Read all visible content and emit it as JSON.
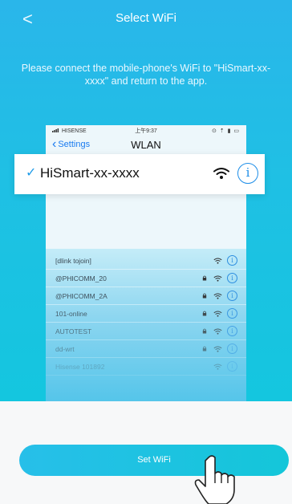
{
  "header": {
    "back_icon": "chevron-left-icon",
    "back_glyph": "<",
    "title": "Select WiFi"
  },
  "instruction": "Please connect the mobile-phone's WiFi to \"HiSmart-xx-xxxx\" and return to the app.",
  "phone": {
    "status": {
      "carrier": "HISENSE",
      "time": "上午9:37",
      "icons": "⊙ ⇡ ▮ ▭"
    },
    "nav": {
      "back_label": "Settings",
      "title": "WLAN"
    },
    "selected_network": {
      "check": "✓",
      "name": "HiSmart-xx-xxxx",
      "info": "i"
    },
    "networks": [
      {
        "name": "[dlink tojoin]",
        "locked": false
      },
      {
        "name": "@PHICOMM_20",
        "locked": true
      },
      {
        "name": "@PHICOMM_2A",
        "locked": true
      },
      {
        "name": "101-online",
        "locked": true
      },
      {
        "name": "AUTOTEST",
        "locked": true
      },
      {
        "name": "dd-wrt",
        "locked": true
      },
      {
        "name": "Hisense 101892",
        "locked": false
      }
    ]
  },
  "actions": {
    "set_wifi_label": "Set WiFi"
  },
  "colors": {
    "accent": "#1e8ee8",
    "gradient_top": "#2ab6ea",
    "gradient_bottom": "#14c6df",
    "button": "#1fc4e0"
  }
}
